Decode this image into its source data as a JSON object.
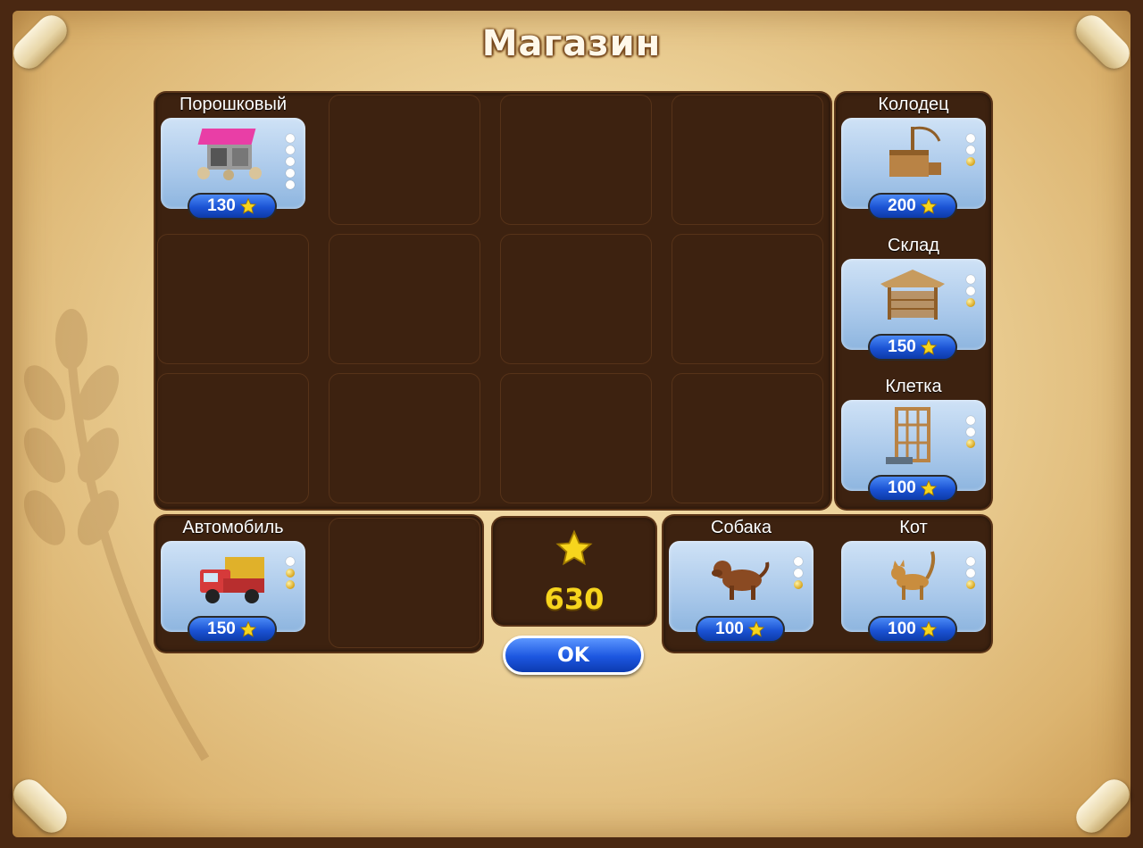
{
  "title": "Магазин",
  "balance": "630",
  "ok_label": "OK",
  "colors": {
    "price_blue": "#1b53d4",
    "coin_gold": "#f7d51d",
    "panel_brown": "#3d2210"
  },
  "items": {
    "powder": {
      "label": "Порошковый",
      "price": "130",
      "icon": "powder-workshop-icon"
    },
    "well": {
      "label": "Колодец",
      "price": "200",
      "icon": "well-icon"
    },
    "storage": {
      "label": "Склад",
      "price": "150",
      "icon": "storage-shed-icon"
    },
    "cage": {
      "label": "Клетка",
      "price": "100",
      "icon": "cage-icon"
    },
    "car": {
      "label": "Автомобиль",
      "price": "150",
      "icon": "truck-icon"
    },
    "dog": {
      "label": "Собака",
      "price": "100",
      "icon": "dog-icon"
    },
    "cat": {
      "label": "Кот",
      "price": "100",
      "icon": "cat-icon"
    }
  }
}
